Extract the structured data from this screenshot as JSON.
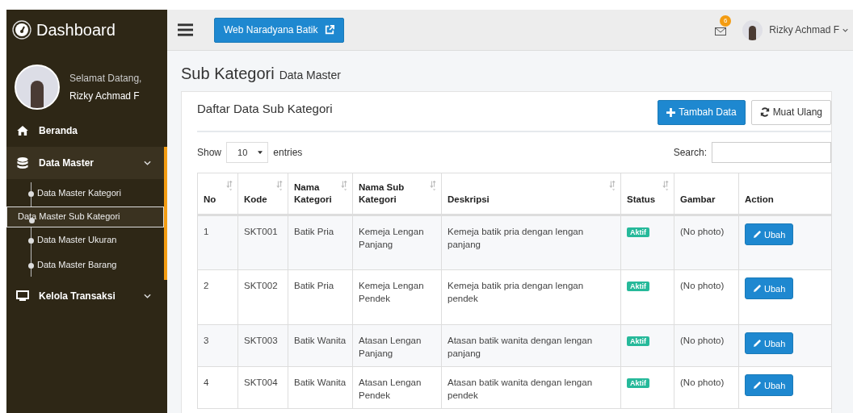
{
  "sidebar": {
    "brand": "Dashboard",
    "greeting": "Selamat Datang,",
    "user_name": "Rizky Achmad F",
    "menu": [
      {
        "label": "Beranda",
        "expanded": false
      },
      {
        "label": "Data Master",
        "expanded": true,
        "children": [
          {
            "label": "Data Master Kategori",
            "selected": false
          },
          {
            "label": "Data Master Sub Kategori",
            "selected": true
          },
          {
            "label": "Data Master Ukuran",
            "selected": false
          },
          {
            "label": "Data Master Barang",
            "selected": false
          }
        ]
      },
      {
        "label": "Kelola Transaksi",
        "expanded": false
      }
    ]
  },
  "topbar": {
    "site_button": "Web Naradyana Batik",
    "mail_count": "6",
    "user_name": "Rizky Achmad F"
  },
  "page": {
    "title": "Sub Kategori",
    "subtitle": "Data Master"
  },
  "panel": {
    "title": "Daftar Data Sub Kategori",
    "add_button": "Tambah Data",
    "reload_button": "Muat Ulang"
  },
  "table_controls": {
    "show_label": "Show",
    "page_size": "10",
    "entries_label": "entries",
    "search_label": "Search:"
  },
  "table": {
    "columns": [
      {
        "label": "No",
        "sortable": true
      },
      {
        "label": "Kode",
        "sortable": true
      },
      {
        "label": "Nama Kategori",
        "sortable": true
      },
      {
        "label": "Nama Sub Kategori",
        "sortable": true
      },
      {
        "label": "Deskripsi",
        "sortable": true
      },
      {
        "label": "Status",
        "sortable": true
      },
      {
        "label": "Gambar",
        "sortable": false
      },
      {
        "label": "Action",
        "sortable": false
      }
    ],
    "rows": [
      {
        "no": "1",
        "kode": "SKT001",
        "kategori": "Batik Pria",
        "sub_kategori": "Kemeja Lengan Panjang",
        "deskripsi": "Kemeja batik pria dengan lengan panjang",
        "status": "Aktif",
        "gambar": "(No photo)",
        "action": "Ubah"
      },
      {
        "no": "2",
        "kode": "SKT002",
        "kategori": "Batik Pria",
        "sub_kategori": "Kemeja Lengan Pendek",
        "deskripsi": "Kemeja batik pria dengan lengan pendek",
        "status": "Aktif",
        "gambar": "(No photo)",
        "action": "Ubah"
      },
      {
        "no": "3",
        "kode": "SKT003",
        "kategori": "Batik Wanita",
        "sub_kategori": "Atasan Lengan Panjang",
        "deskripsi": "Atasan batik wanita dengan lengan panjang",
        "status": "Aktif",
        "gambar": "(No photo)",
        "action": "Ubah"
      },
      {
        "no": "4",
        "kode": "SKT004",
        "kategori": "Batik Wanita",
        "sub_kategori": "Atasan Lengan Pendek",
        "deskripsi": "Atasan batik wanita dengan lengan pendek",
        "status": "Aktif",
        "gambar": "(No photo)",
        "action": "Ubah"
      }
    ]
  }
}
